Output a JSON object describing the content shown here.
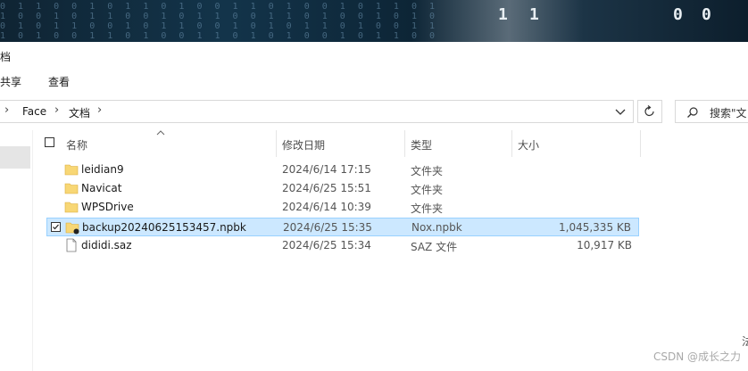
{
  "banner": {
    "digits": [
      "1",
      "1",
      "0",
      "0"
    ]
  },
  "window": {
    "title": "档"
  },
  "ribbon": {
    "tabs": [
      "共享",
      "查看"
    ]
  },
  "address": {
    "segments": [
      "Face",
      "文档"
    ],
    "search_placeholder": "搜索\"文"
  },
  "columns": {
    "name": "名称",
    "modified": "修改日期",
    "type": "类型",
    "size": "大小"
  },
  "files": [
    {
      "name": "leidian9",
      "modified": "2024/6/14 17:15",
      "type": "文件夹",
      "size": "",
      "icon": "folder-icon",
      "selected": false
    },
    {
      "name": "Navicat",
      "modified": "2024/6/25 15:51",
      "type": "文件夹",
      "size": "",
      "icon": "folder-icon",
      "selected": false
    },
    {
      "name": "WPSDrive",
      "modified": "2024/6/14 10:39",
      "type": "文件夹",
      "size": "",
      "icon": "folder-icon",
      "selected": false
    },
    {
      "name": "backup20240625153457.npbk",
      "modified": "2024/6/25 15:35",
      "type": "Nox.npbk",
      "size": "1,045,335 KB",
      "icon": "npbk-file-icon",
      "selected": true
    },
    {
      "name": "dididi.saz",
      "modified": "2024/6/25 15:34",
      "type": "SAZ 文件",
      "size": "10,917 KB",
      "icon": "file-icon",
      "selected": false
    }
  ],
  "watermark": "CSDN @成长之力",
  "edge_char": "法",
  "colors": {
    "selection": "#cce8ff",
    "folder": "#f8d775"
  }
}
